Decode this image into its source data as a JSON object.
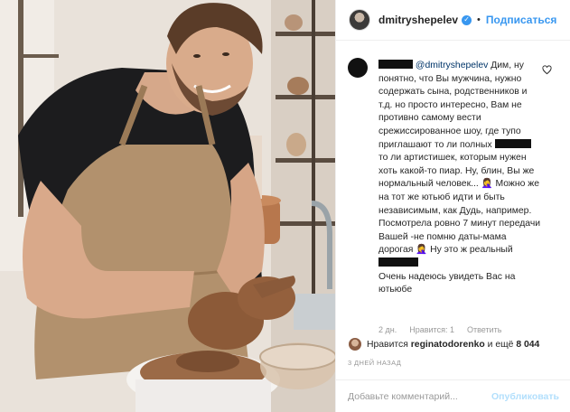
{
  "header": {
    "username": "dmitryshepelev",
    "verified_mark": "✓",
    "separator": "•",
    "follow_label": "Подписаться"
  },
  "comment": {
    "mention": "@dmitryshepelev",
    "part1": "Дим, ну понятно, что Вы мужчина, нужно содержать сына, родственников и т.д. но просто интересно, Вам не противно самому вести срежиссированное шоу, где тупо приглашают то ли полных",
    "part2": "то ли артистишек, которым нужен хоть какой-то пиар. Ну, блин, Вы же нормальный человек... 🤦‍♀️ Можно же на тот же ютьюб идти и быть независимым, как Дудь, например. Посмотрела ровно 7 минут передачи Вашей -не помню даты-мама дорогая 🤦‍♀️ Ну это ж реальный",
    "part3": "Очень надеюсь увидеть Вас на ютьюбе",
    "time": "2 дн.",
    "likes": "Нравится: 1",
    "reply": "Ответить"
  },
  "post": {
    "likes_prefix": "Нравится",
    "likes_user": "reginatodorenko",
    "likes_suffix": "и ещё",
    "likes_count": "8 044",
    "time_ago": "3 ДНЕЙ НАЗАД"
  },
  "add_comment": {
    "placeholder": "Добавьте комментарий...",
    "publish_label": "Опубликовать"
  },
  "colors": {
    "accent": "#3897f0",
    "publish_disabled": "#b2dffc",
    "meta_gray": "#999999"
  }
}
